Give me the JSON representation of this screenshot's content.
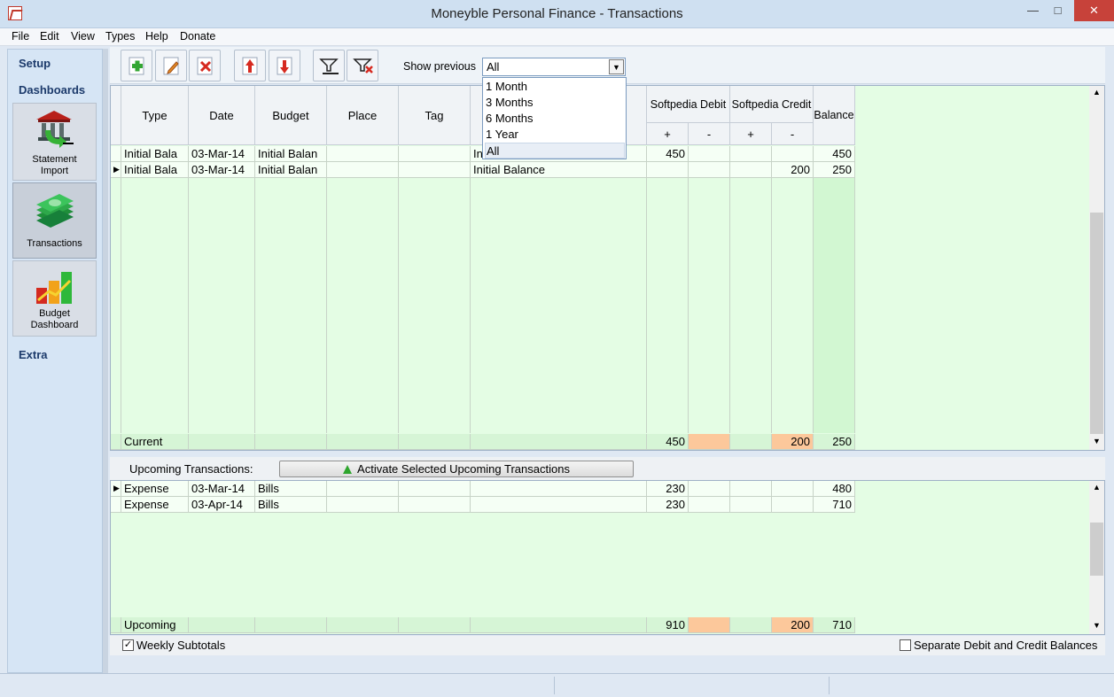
{
  "window": {
    "title": "Moneyble Personal Finance - Transactions"
  },
  "menu": [
    "File",
    "Edit",
    "View",
    "Types",
    "Help",
    "Donate"
  ],
  "nav": {
    "setup": "Setup",
    "dashboards": "Dashboards",
    "extra": "Extra",
    "statement_import": [
      "Statement",
      "Import"
    ],
    "transactions": "Transactions",
    "budget_dashboard": [
      "Budget",
      "Dashboard"
    ]
  },
  "toolbar": {
    "show_previous_label": "Show previous",
    "show_previous_value": "All"
  },
  "dropdown_options": [
    "1 Month",
    "3 Months",
    "6 Months",
    "1 Year",
    "All"
  ],
  "grid": {
    "headers": {
      "type": "Type",
      "date": "Date",
      "budget": "Budget",
      "place": "Place",
      "tag": "Tag",
      "debit": "Softpedia Debit",
      "credit": "Softpedia Credit",
      "balance": "Balance",
      "plus": "+",
      "minus": "-"
    },
    "rows": [
      {
        "type": "Initial Bala",
        "date": "03-Mar-14",
        "budget": "Initial Balan",
        "desc": "In",
        "debit_plus": "450",
        "credit_minus": "",
        "balance": "450"
      },
      {
        "type": "Initial Bala",
        "date": "03-Mar-14",
        "budget": "Initial Balan",
        "desc": "Initial Balance",
        "debit_plus": "",
        "credit_minus": "200",
        "balance": "250"
      }
    ],
    "total": {
      "label": "Current",
      "debit_plus": "450",
      "credit_minus": "200",
      "balance": "250"
    }
  },
  "upcoming": {
    "label": "Upcoming Transactions:",
    "activate_button": "Activate Selected Upcoming Transactions",
    "rows": [
      {
        "type": "Expense",
        "date": "03-Mar-14",
        "budget": "Bills",
        "debit_plus": "230",
        "balance": "480"
      },
      {
        "type": "Expense",
        "date": "03-Apr-14",
        "budget": "Bills",
        "debit_plus": "230",
        "balance": "710"
      }
    ],
    "total": {
      "label": "Upcoming",
      "debit_plus": "910",
      "credit_minus": "200",
      "balance": "710"
    }
  },
  "bottom": {
    "weekly_subtotals": "Weekly Subtotals",
    "separate_balances": "Separate Debit and Credit Balances"
  },
  "colors": {
    "grid_bg": "#e4fde4",
    "peach": "#fcc89b",
    "title_bg": "#cfe0f1"
  }
}
